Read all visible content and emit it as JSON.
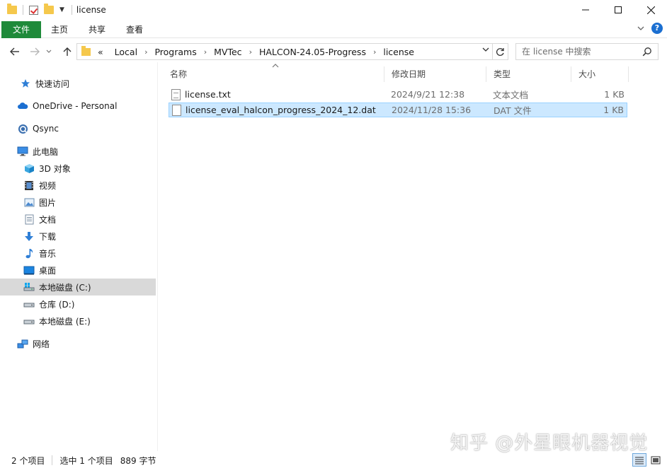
{
  "window": {
    "title": "license",
    "controls": {
      "minimize": "—",
      "maximize": "☐",
      "close": "✕"
    }
  },
  "ribbon": {
    "tabs": [
      "文件",
      "主页",
      "共享",
      "查看"
    ]
  },
  "address": {
    "overflow": "«",
    "crumbs": [
      "Local",
      "Programs",
      "MVTec",
      "HALCON-24.05-Progress",
      "license"
    ],
    "separator": "›"
  },
  "search": {
    "placeholder": "在 license 中搜索"
  },
  "sidebar": {
    "items": [
      {
        "label": "快速访问",
        "icon": "star-icon"
      },
      {
        "label": "OneDrive - Personal",
        "icon": "cloud-icon"
      },
      {
        "label": "Qsync",
        "icon": "qsync-icon"
      },
      {
        "label": "此电脑",
        "icon": "computer-icon"
      },
      {
        "label": "3D 对象",
        "icon": "cube-icon"
      },
      {
        "label": "视频",
        "icon": "video-icon"
      },
      {
        "label": "图片",
        "icon": "picture-icon"
      },
      {
        "label": "文档",
        "icon": "document-icon"
      },
      {
        "label": "下载",
        "icon": "download-icon"
      },
      {
        "label": "音乐",
        "icon": "music-icon"
      },
      {
        "label": "桌面",
        "icon": "desktop-icon"
      },
      {
        "label": "本地磁盘 (C:)",
        "icon": "drive-c-icon",
        "selected": true
      },
      {
        "label": "仓库 (D:)",
        "icon": "drive-icon"
      },
      {
        "label": "本地磁盘 (E:)",
        "icon": "drive-icon"
      },
      {
        "label": "网络",
        "icon": "network-icon"
      }
    ]
  },
  "columns": {
    "name": "名称",
    "date": "修改日期",
    "type": "类型",
    "size": "大小"
  },
  "files": [
    {
      "name": "license.txt",
      "date": "2024/9/21 12:38",
      "type": "文本文档",
      "size": "1 KB"
    },
    {
      "name": "license_eval_halcon_progress_2024_12.dat",
      "date": "2024/11/28 15:36",
      "type": "DAT 文件",
      "size": "1 KB",
      "selected": true
    }
  ],
  "status": {
    "count": "2 个项目",
    "selection": "选中 1 个项目",
    "size": "889 字节"
  },
  "watermark": "知乎 @外星眼机器视觉",
  "colors": {
    "file_tab": "#1f8a3a",
    "selection": "#cce8ff",
    "selection_border": "#99d1ff",
    "folder": "#f5c84c",
    "accent": "#1b6fd1"
  }
}
